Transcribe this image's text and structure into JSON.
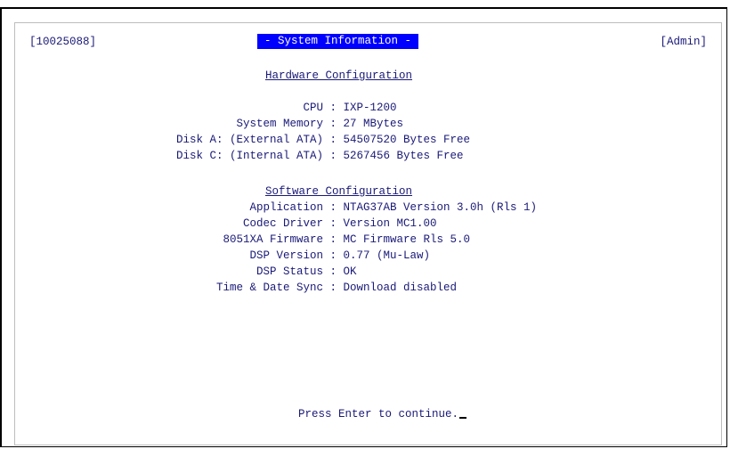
{
  "header": {
    "terminal_id": "[10025088]",
    "title": "- System Information -",
    "user_role": "[Admin]"
  },
  "hardware": {
    "heading": "Hardware Configuration",
    "rows": [
      {
        "label": "CPU",
        "value": "IXP-1200"
      },
      {
        "label": "System Memory",
        "value": "27 MBytes"
      },
      {
        "label": "Disk A: (External ATA)",
        "value": "54507520 Bytes Free"
      },
      {
        "label": "Disk C: (Internal ATA)",
        "value": "5267456 Bytes Free"
      }
    ]
  },
  "software": {
    "heading": "Software Configuration",
    "rows": [
      {
        "label": "Application",
        "value": "NTAG37AB Version 3.0h (Rls 1)"
      },
      {
        "label": "Codec Driver",
        "value": "Version MC1.00"
      },
      {
        "label": "8051XA Firmware",
        "value": "MC Firmware Rls 5.0"
      },
      {
        "label": "DSP Version",
        "value": "0.77 (Mu-Law)"
      },
      {
        "label": "DSP Status",
        "value": "OK"
      },
      {
        "label": "Time & Date Sync",
        "value": "Download disabled"
      }
    ]
  },
  "footer": {
    "prompt": "Press Enter to continue."
  },
  "separator": " : ",
  "colors": {
    "text": "#1a1a78",
    "title_bg": "#0000ff",
    "title_fg": "#ffffff"
  }
}
